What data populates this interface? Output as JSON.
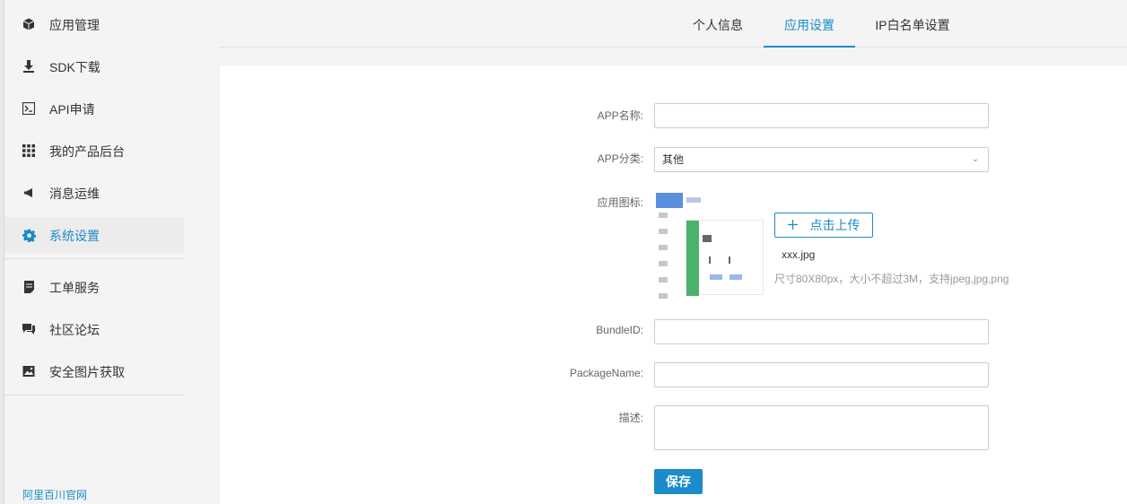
{
  "sidebar": {
    "items": [
      {
        "label": "应用管理",
        "icon": "cube-icon"
      },
      {
        "label": "SDK下载",
        "icon": "download-icon"
      },
      {
        "label": "API申请",
        "icon": "terminal-icon"
      },
      {
        "label": "我的产品后台",
        "icon": "grid-icon"
      },
      {
        "label": "消息运维",
        "icon": "megaphone-icon"
      },
      {
        "label": "系统设置",
        "icon": "gear-icon",
        "active": true
      },
      {
        "label": "工单服务",
        "icon": "ticket-icon"
      },
      {
        "label": "社区论坛",
        "icon": "chat-icon"
      },
      {
        "label": "安全图片获取",
        "icon": "image-icon"
      }
    ],
    "footer_link": "阿里百川官网"
  },
  "tabs": [
    {
      "label": "个人信息"
    },
    {
      "label": "应用设置",
      "active": true
    },
    {
      "label": "IP白名单设置"
    }
  ],
  "form": {
    "app_name": {
      "label": "APP名称:",
      "value": ""
    },
    "app_category": {
      "label": "APP分类:",
      "value": "其他"
    },
    "app_icon": {
      "label": "应用图标:",
      "upload_label": "点击上传",
      "file_name": "xxx.jpg",
      "hint": "尺寸80X80px，大小不超过3M，支持jpeg,jpg,png"
    },
    "bundle_id": {
      "label": "BundleID:",
      "value": ""
    },
    "package_name": {
      "label": "PackageName:",
      "value": ""
    },
    "description": {
      "label": "描述:",
      "value": ""
    },
    "save_label": "保存"
  },
  "colors": {
    "accent": "#1b8bc9",
    "preview_green": "#4cb36d",
    "preview_blue": "#5b8fe0"
  }
}
